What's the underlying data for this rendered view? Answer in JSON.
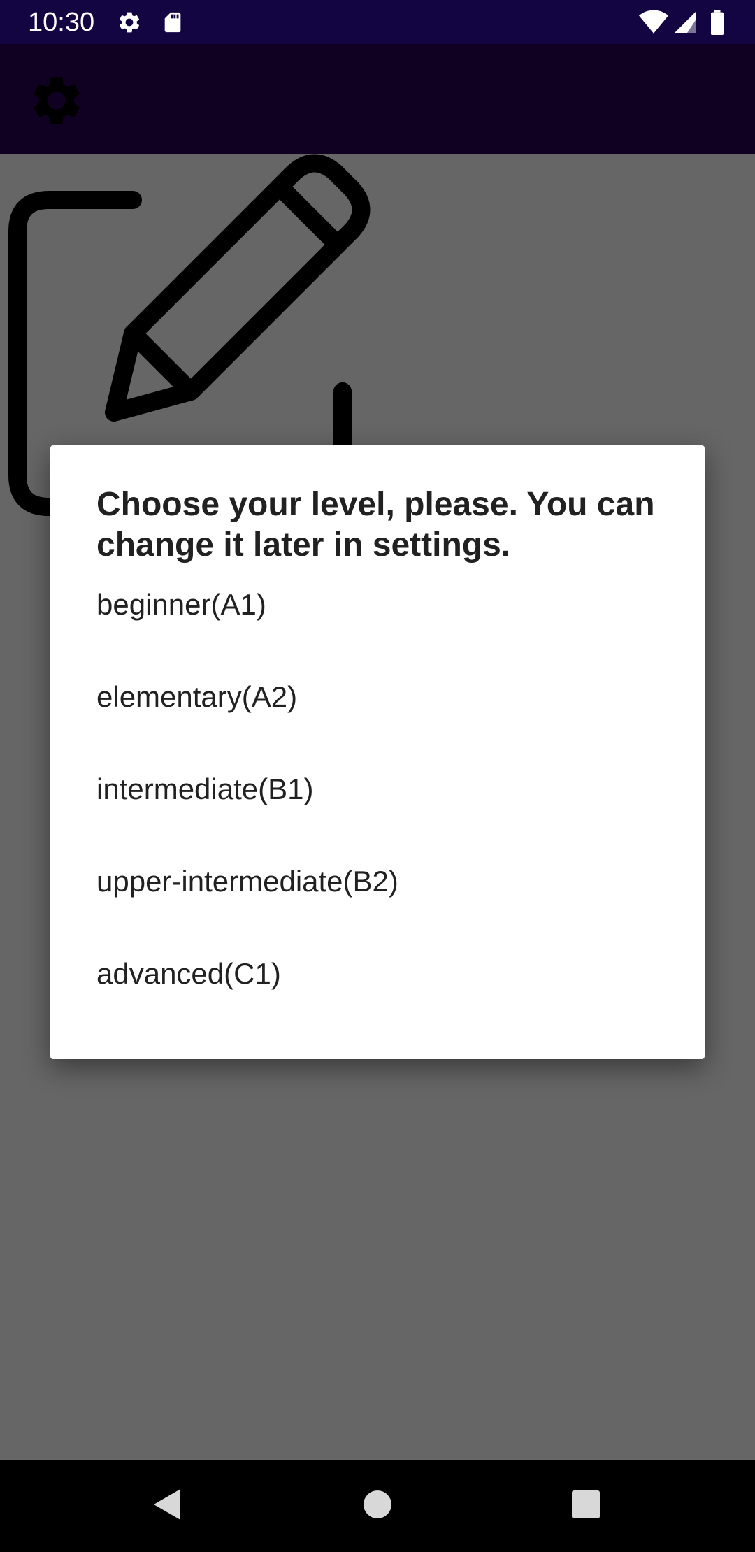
{
  "status_bar": {
    "time": "10:30",
    "icons": [
      "settings-icon",
      "sd-card-icon",
      "wifi-icon",
      "signal-icon",
      "battery-icon"
    ]
  },
  "app_bar": {
    "settings_icon": "gear-icon",
    "background": "#2a0356"
  },
  "content": {
    "illustration_icon": "edit-note-icon"
  },
  "dialog": {
    "title": "Choose your level, please. You can change it later in settings.",
    "options": [
      "beginner(A1)",
      "elementary(A2)",
      "intermediate(B1)",
      "upper-intermediate(B2)",
      "advanced(C1)"
    ]
  },
  "nav_bar": {
    "buttons": [
      "back-icon",
      "home-icon",
      "recents-icon"
    ]
  },
  "colors": {
    "status_bar": "#130442",
    "app_bar": "#2a0356",
    "scrim": "rgba(0,0,0,0.6)",
    "dialog_bg": "#ffffff",
    "text": "#212121"
  }
}
